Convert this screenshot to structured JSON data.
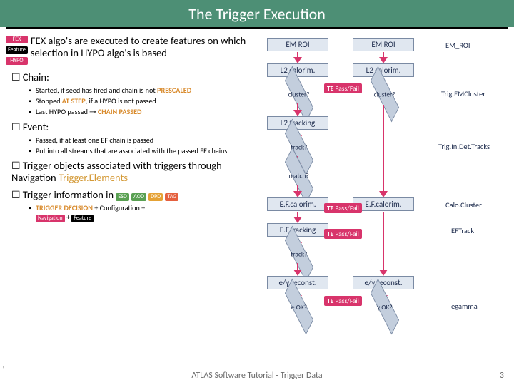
{
  "title": "The Trigger Execution",
  "intro": {
    "labels": {
      "fex": "FEX",
      "feat": "Feature",
      "hypo": "HYPO"
    },
    "text": "FEX algo's are executed to create features on which selection in HYPO algo's is based"
  },
  "chain": {
    "heading": "Chain:",
    "items": [
      {
        "pre": "Started, if seed has fired and chain is not ",
        "em": "PRESCALED",
        "cls": "em-orange"
      },
      {
        "pre": "Stopped ",
        "em": "AT STEP",
        "post": ", if a HYPO is not passed",
        "cls": "em-orange"
      },
      {
        "pre": "Last HYPO passed → ",
        "em": "CHAIN PASSED",
        "cls": "em-orange"
      }
    ]
  },
  "event": {
    "heading": "Event:",
    "items": [
      "Passed, if at least one EF chain is passed",
      "Put into all streams that are associated with the passed EF chains"
    ]
  },
  "nav": {
    "heading_pre": "Trigger objects associated with triggers through Navigation ",
    "heading_link": "Trigger.Elements"
  },
  "info": {
    "heading_pre": "Trigger information in ",
    "pills": {
      "esd": "ESD",
      "aod": "AOD",
      "dpd": "DPD",
      "tag": "TAG"
    },
    "line": {
      "a": "TRIGGER DECISION",
      "b": " + Configuration + ",
      "nav": "Navigation",
      "c": " + ",
      "feat": "Feature"
    }
  },
  "diagram": {
    "emroi": "EM ROI",
    "emroi2": "EM_ROI",
    "l2cal": "L2 calorim.",
    "cluster": "cluster?",
    "te": "TE Pass/Fail",
    "trigem": "Trig.EMCluster",
    "l2trk": "L2 tracking",
    "track": "track?",
    "trigtrk": "Trig.In.Det.Tracks",
    "match": "match?",
    "efcal": "E.F.calorim.",
    "calocl": "Calo.Cluster",
    "eftrk": "E.F.tracking",
    "eftrack": "EFTrack",
    "recon": "e/γ reconst.",
    "eok": "e OK?",
    "gok": "γ OK?",
    "egamma": "egamma"
  },
  "footer": "ATLAS Software Tutorial - Trigger Data",
  "page": "3"
}
